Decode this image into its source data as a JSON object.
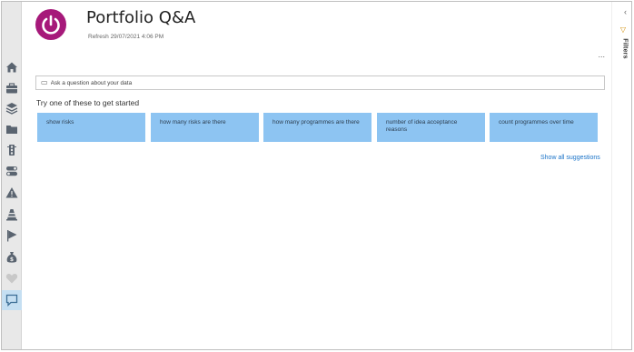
{
  "header": {
    "title": "Portfolio Q&A",
    "refresh": "Refresh 29/07/2021 4:06 PM"
  },
  "sidebar": {
    "items": [
      {
        "icon": "home-icon",
        "active": false
      },
      {
        "icon": "briefcase-icon",
        "active": false
      },
      {
        "icon": "layers-icon",
        "active": false
      },
      {
        "icon": "folder-icon",
        "active": false
      },
      {
        "icon": "traffic-light-icon",
        "active": false
      },
      {
        "icon": "toggle-icon",
        "active": false
      },
      {
        "icon": "warning-icon",
        "active": false
      },
      {
        "icon": "cone-icon",
        "active": false
      },
      {
        "icon": "flag-icon",
        "active": false
      },
      {
        "icon": "money-bag-icon",
        "active": false
      },
      {
        "icon": "heart-icon",
        "active": false
      },
      {
        "icon": "chat-icon",
        "active": true
      }
    ]
  },
  "right_panel": {
    "collapse": "‹",
    "filters_label": "Filters",
    "more": "..."
  },
  "qa": {
    "placeholder": "Ask a question about your data",
    "try_text": "Try one of these to get started",
    "suggestions": [
      "show risks",
      "how many risks are there",
      "how many programmes are there",
      "number of idea acceptance reasons",
      "count programmes over time"
    ],
    "show_all": "Show all suggestions"
  },
  "colors": {
    "accent": "#a6197a",
    "suggestion_bg": "#8dc4f2",
    "link": "#1a73c8"
  }
}
